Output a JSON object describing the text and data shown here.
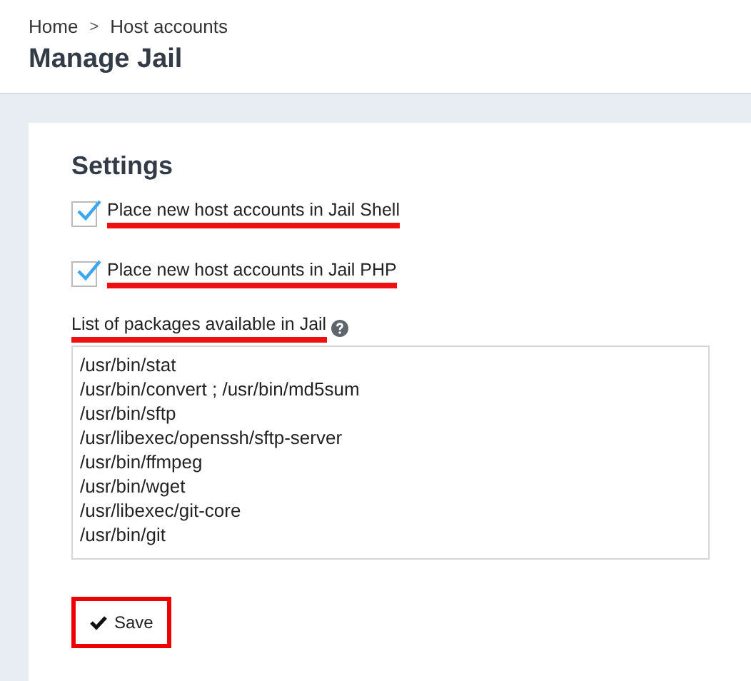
{
  "breadcrumb": [
    {
      "label": "Home"
    },
    {
      "label": "Host accounts"
    }
  ],
  "breadcrumb_separator": ">",
  "page_title": "Manage Jail",
  "settings": {
    "title": "Settings",
    "checkboxes": [
      {
        "label": "Place new host accounts in Jail Shell",
        "checked": true,
        "annotated": true
      },
      {
        "label": "Place new host accounts in Jail PHP",
        "checked": true,
        "annotated": true
      }
    ],
    "packages": {
      "label": "List of packages available in Jail",
      "annotated": true,
      "lines": [
        "/usr/bin/stat",
        "/usr/bin/convert ; /usr/bin/md5sum",
        "/usr/bin/sftp",
        "/usr/libexec/openssh/sftp-server",
        "/usr/bin/ffmpeg",
        "/usr/bin/wget",
        "/usr/libexec/git-core",
        "/usr/bin/git"
      ]
    },
    "save_button": {
      "label": "Save",
      "annotated": true
    }
  }
}
